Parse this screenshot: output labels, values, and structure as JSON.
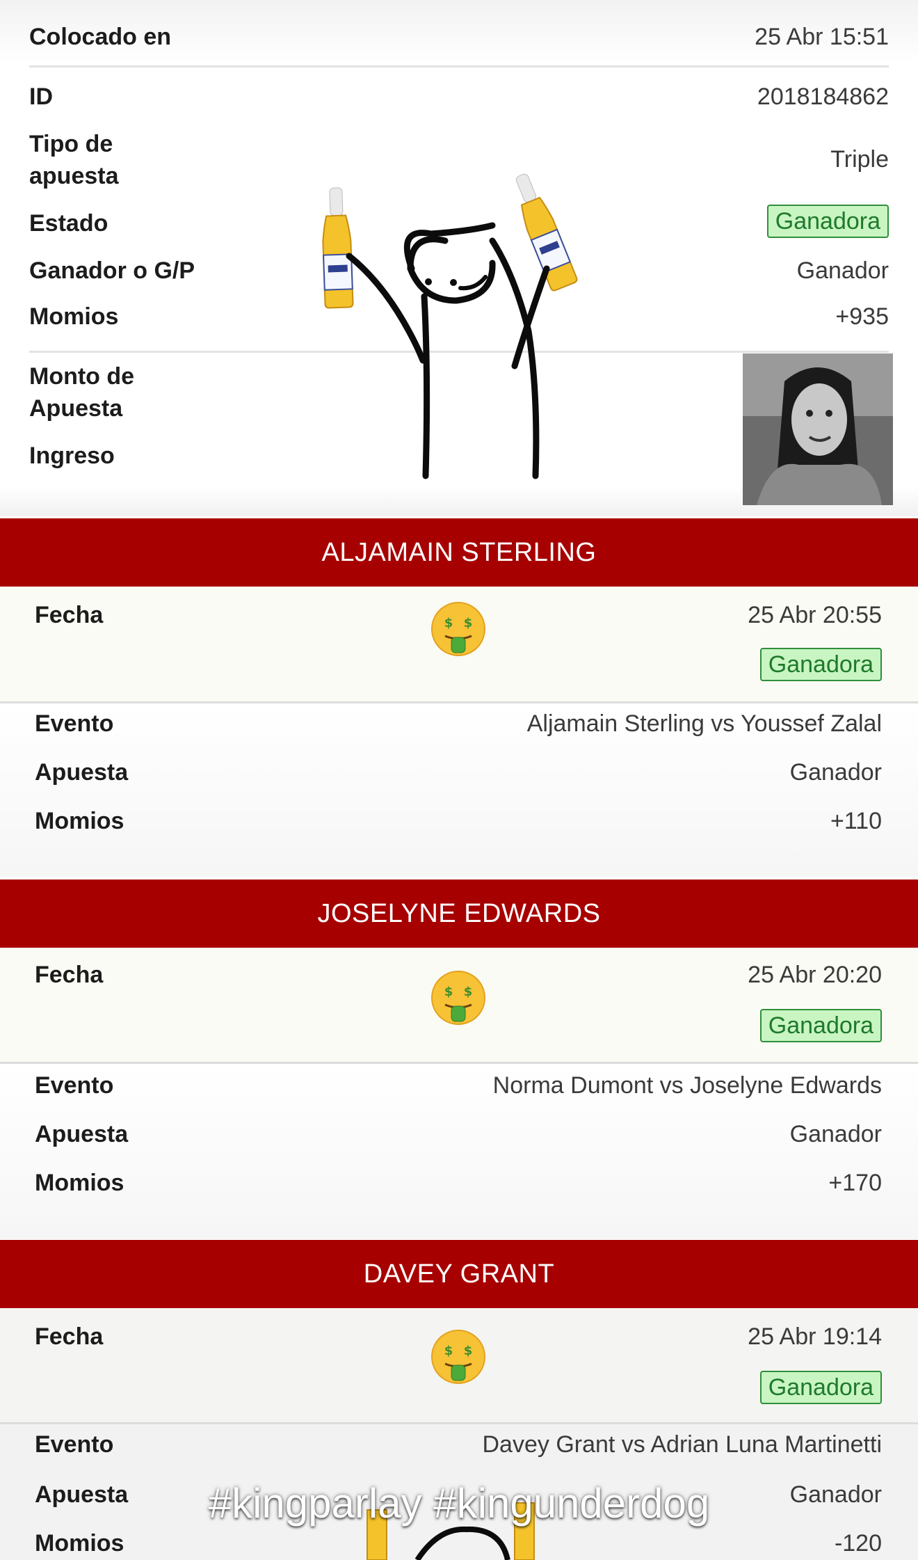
{
  "summary": {
    "placed_label": "Colocado en",
    "placed_value": "25 Abr 15:51",
    "id_label": "ID",
    "id_value": "2018184862",
    "type_label_1": "Tipo de",
    "type_label_2": "apuesta",
    "type_value": "Triple",
    "state_label": "Estado",
    "state_value": "Ganadora",
    "winner_label": "Ganador o G/P",
    "winner_value": "Ganador",
    "odds_label": "Momios",
    "odds_value": "+935",
    "amount_label_1": "Monto de",
    "amount_label_2": "Apuesta",
    "income_label": "Ingreso"
  },
  "legs": [
    {
      "fighter": "ALJAMAIN STERLING",
      "date_label": "Fecha",
      "date_value": "25 Abr 20:55",
      "status": "Ganadora",
      "event_label": "Evento",
      "event_value": "Aljamain Sterling vs Youssef Zalal",
      "bet_label": "Apuesta",
      "bet_value": "Ganador",
      "odds_label": "Momios",
      "odds_value": "+110"
    },
    {
      "fighter": "JOSELYNE EDWARDS",
      "date_label": "Fecha",
      "date_value": "25 Abr 20:20",
      "status": "Ganadora",
      "event_label": "Evento",
      "event_value": "Norma Dumont vs Joselyne Edwards",
      "bet_label": "Apuesta",
      "bet_value": "Ganador",
      "odds_label": "Momios",
      "odds_value": "+170"
    },
    {
      "fighter": "DAVEY GRANT",
      "date_label": "Fecha",
      "date_value": "25 Abr 19:14",
      "status": "Ganadora",
      "event_label": "Evento",
      "event_value": "Davey Grant vs Adrian Luna Martinetti",
      "bet_label": "Apuesta",
      "bet_value": "Ganador",
      "odds_label": "Momios",
      "odds_value": "-120"
    }
  ],
  "overlay": {
    "hashtags": "#kingparlay #kingunderdog",
    "sticker_icon": "stick-figure-with-beer-bottles-sticker",
    "emoji_icon": "money-mouth-face-emoji",
    "photo_icon": "person-photo-sticker"
  },
  "colors": {
    "banner": "#a70000",
    "badge_bg": "#c9f5c3",
    "badge_border": "#2f8f3a",
    "badge_text": "#1e7a2a"
  }
}
